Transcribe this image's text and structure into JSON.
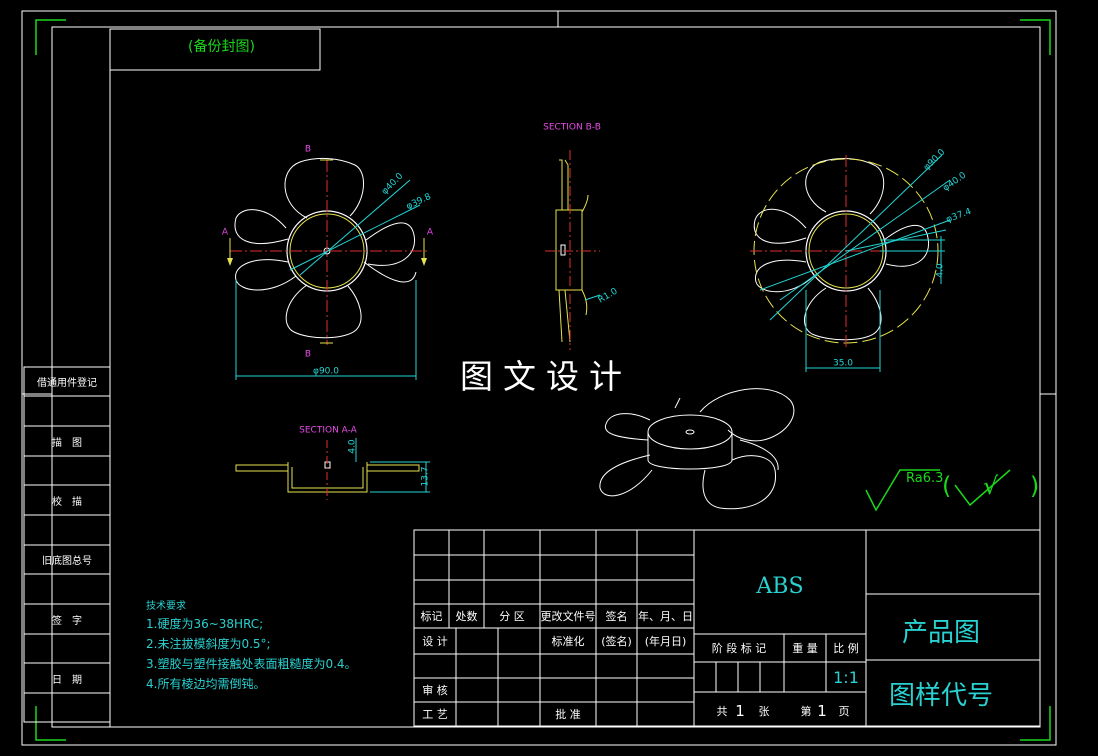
{
  "drawing": {
    "top_box_text": "(备份封图)",
    "watermark": "图文设计",
    "section_bb": "SECTION B-B",
    "section_aa": "SECTION A-A",
    "label_a": "A",
    "label_b": "B",
    "dims": {
      "d40_left": "φ40.0",
      "d39_8": "φ39.8",
      "d90_left": "φ90.0",
      "r1": "R1.0",
      "h4_aa": "4.0",
      "h13_7": "13.7",
      "d90_right": "φ90.0",
      "d40_right": "φ40.0",
      "d37_4": "φ37.4",
      "h4_right": "4.0",
      "w35": "35.0"
    },
    "roughness": "Ra6.3",
    "roughness_paren": "( √ )"
  },
  "side_labels": [
    "借通用件登记",
    "描　图",
    "校　描",
    "旧底图总号",
    "签　字",
    "日　期"
  ],
  "tech_requirements": {
    "title": "技术要求",
    "items": [
      "1.硬度为36~38HRC;",
      "2.未注拔模斜度为0.5°;",
      "3.塑胶与塑件接触处表面粗糙度为0.4。",
      "4.所有棱边均需倒钝。"
    ]
  },
  "title_block": {
    "headers": [
      "标记",
      "处数",
      "分 区",
      "更改文件号",
      "签名",
      "年、月、日"
    ],
    "design": "设 计",
    "standard": "标准化",
    "signature": "(签名)",
    "date": "(年月日)",
    "review": "审 核",
    "process": "工 艺",
    "approve": "批 准",
    "material": "ABS",
    "stage_headers": [
      "阶 段 标 记",
      "重 量",
      "比 例"
    ],
    "scale": "1:1",
    "sheets": [
      "共",
      "1",
      "张",
      "第",
      "1",
      "页"
    ],
    "product_name": "产品图",
    "drawing_code": "图样代号"
  }
}
